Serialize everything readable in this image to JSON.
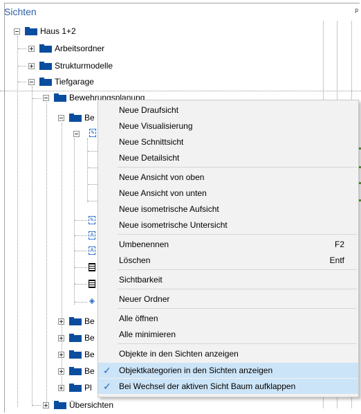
{
  "panel": {
    "title": "Sichten",
    "pin_glyph": "ᵖ"
  },
  "tree": {
    "haus": "Haus 1+2",
    "arbeitsordner": "Arbeitsordner",
    "strukturmodelle": "Strukturmodelle",
    "tiefgarage": "Tiefgarage",
    "bewehrungsplanung": "Bewehrungsplanung",
    "be_prefix": "Be",
    "pl_prefix": "Pl",
    "uebersichten": "Übersichten"
  },
  "menu": {
    "items": [
      {
        "label": "Neue Draufsicht"
      },
      {
        "label": "Neue Visualisierung"
      },
      {
        "label": "Neue Schnittsicht"
      },
      {
        "label": "Neue Detailsicht"
      },
      {
        "label": "Neue Ansicht von oben"
      },
      {
        "label": "Neue Ansicht von unten"
      },
      {
        "label": "Neue isometrische Aufsicht"
      },
      {
        "label": "Neue isometrische Untersicht"
      },
      {
        "label": "Umbenennen",
        "shortcut": "F2"
      },
      {
        "label": "Löschen",
        "shortcut": "Entf"
      },
      {
        "label": "Sichtbarkeit"
      },
      {
        "label": "Neuer Ordner"
      },
      {
        "label": "Alle öffnen"
      },
      {
        "label": "Alle minimieren"
      },
      {
        "label": "Objekte in den Sichten anzeigen"
      },
      {
        "label": "Objektkategorien in den Sichten anzeigen",
        "checked": true
      },
      {
        "label": "Bei Wechsel der aktiven Sicht Baum aufklappen",
        "checked": true
      }
    ],
    "check_glyph": "✓"
  },
  "colors": {
    "title": "#2b5fa8",
    "folder": "#0a4d9e",
    "menu_bg": "#f2f2f2",
    "checked_bg": "#cce4f7"
  }
}
